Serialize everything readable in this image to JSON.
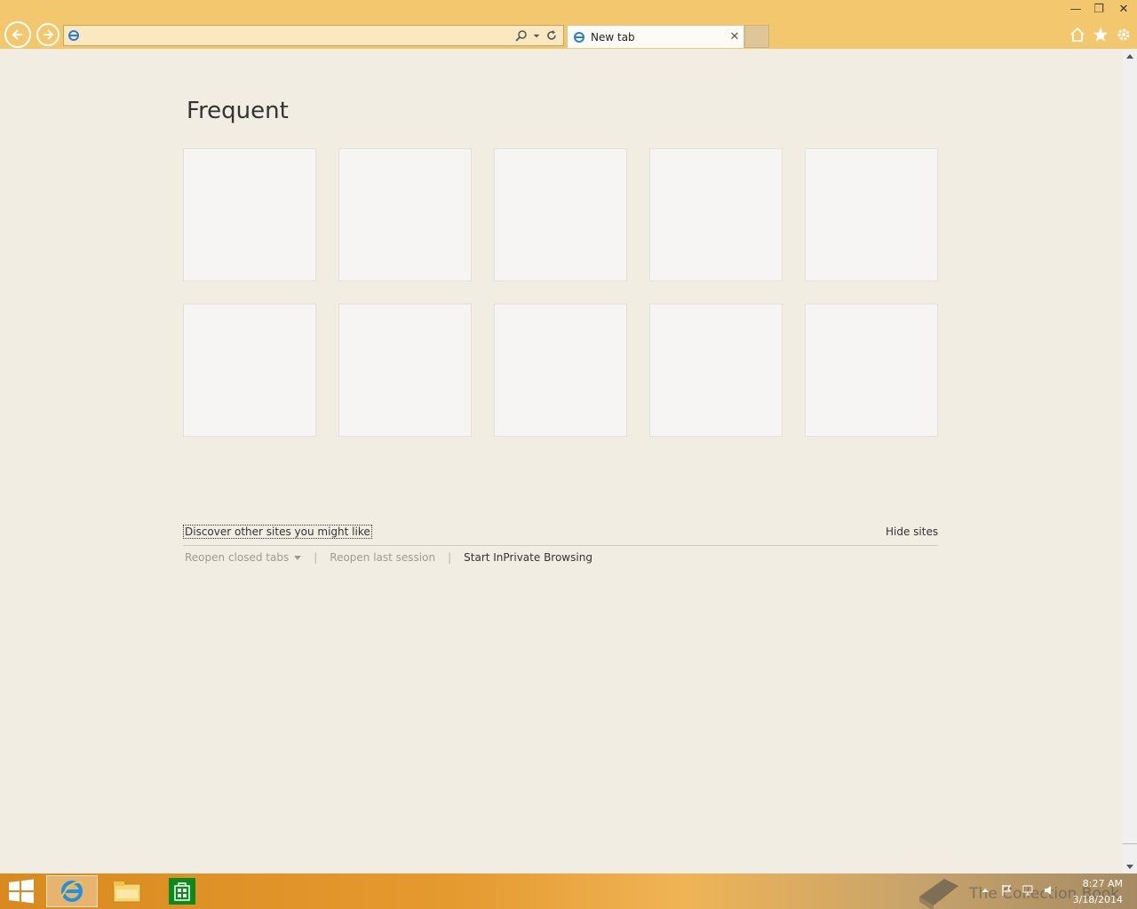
{
  "browser": {
    "address": {
      "value": "",
      "placeholder": ""
    },
    "tab": {
      "title": "New tab",
      "close_glyph": "✕"
    },
    "window_controls": {
      "minimize": "—",
      "restore": "❐",
      "close": "✕"
    },
    "icons": {
      "back": "back-arrow-icon",
      "forward": "forward-arrow-icon",
      "search": "search-icon",
      "refresh": "refresh-icon",
      "home": "home-icon",
      "favorites": "star-icon",
      "tools": "gear-icon"
    }
  },
  "newtab_page": {
    "heading": "Frequent",
    "tile_count": 10,
    "discover_link": "Discover other sites you might like",
    "hide_sites": "Hide sites",
    "reopen_closed_tabs": "Reopen closed tabs",
    "reopen_last_session": "Reopen last session",
    "start_inprivate": "Start InPrivate Browsing",
    "separator": "|"
  },
  "taskbar": {
    "apps": [
      "Internet Explorer",
      "File Explorer",
      "Store"
    ],
    "watermark": "The Collection Book",
    "time": "8:27 AM",
    "date": "3/18/2014"
  },
  "colors": {
    "chrome": "#f2c76d",
    "page_background": "#f2ede3",
    "tile": "#f6f5f3"
  }
}
